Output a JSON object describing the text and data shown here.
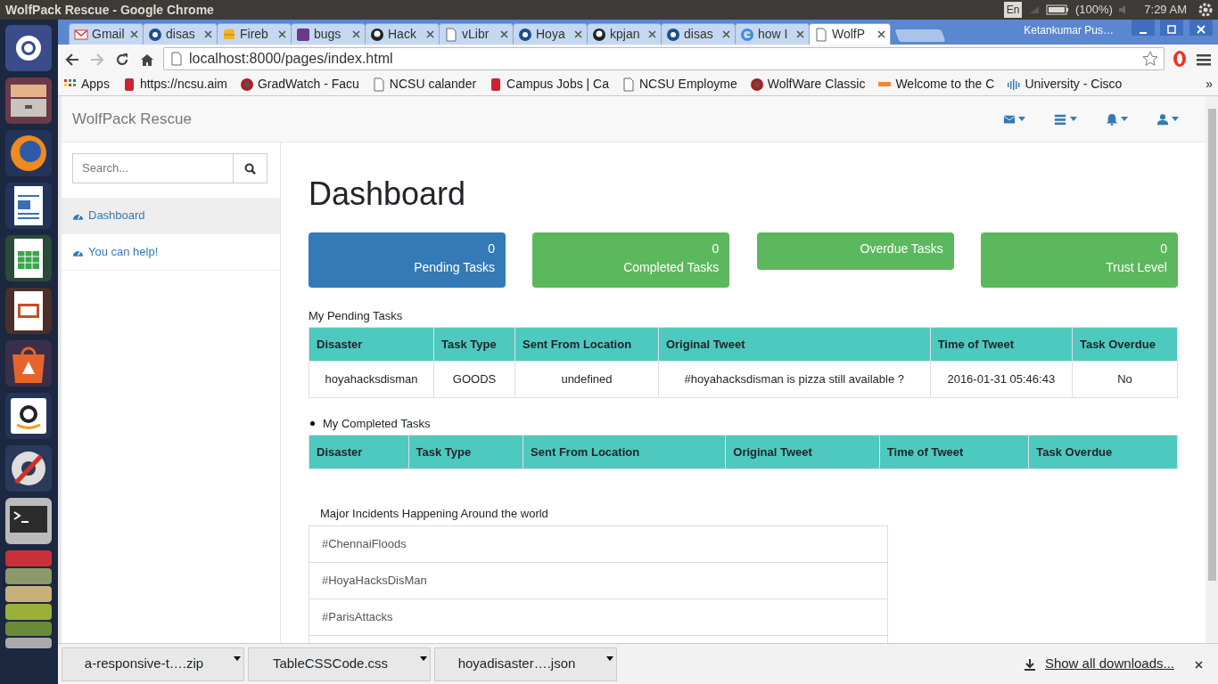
{
  "os_bar": {
    "title": "WolfPack Rescue - Google Chrome",
    "keyboard": "En",
    "battery": "(100%)",
    "time": "7:29 AM"
  },
  "launcher": [
    {
      "kind": "ubuntu"
    },
    {
      "kind": "files"
    },
    {
      "kind": "browser"
    },
    {
      "kind": "writer"
    },
    {
      "kind": "calc"
    },
    {
      "kind": "impress"
    },
    {
      "kind": "software"
    },
    {
      "kind": "shop"
    },
    {
      "kind": "settings"
    },
    {
      "kind": "terminal"
    },
    {
      "kind": "stack"
    }
  ],
  "tabs": [
    {
      "kind": "mail",
      "title": "Gmail",
      "selected": false
    },
    {
      "kind": "disc",
      "title": "disas",
      "selected": false
    },
    {
      "kind": "db",
      "title": "Fireb",
      "selected": false
    },
    {
      "kind": "square",
      "title": "bugs",
      "selected": false
    },
    {
      "kind": "cat",
      "title": "Hack",
      "selected": false
    },
    {
      "kind": "page",
      "title": "vLibr",
      "selected": false
    },
    {
      "kind": "disc",
      "title": "Hoya",
      "selected": false
    },
    {
      "kind": "cat",
      "title": "kpjan",
      "selected": false
    },
    {
      "kind": "disc",
      "title": "disas",
      "selected": false
    },
    {
      "kind": "ring",
      "title": "how I",
      "selected": false
    },
    {
      "kind": "page",
      "title": "WolfP",
      "selected": true
    }
  ],
  "profile": "Ketankumar Pus…",
  "address": "localhost:8000/pages/index.html",
  "bookmarks": [
    {
      "kind": "apps",
      "label": "Apps"
    },
    {
      "kind": "red",
      "label": "https://ncsu.aim"
    },
    {
      "kind": "wolf",
      "label": "GradWatch - Facu"
    },
    {
      "kind": "page",
      "label": "NCSU calander"
    },
    {
      "kind": "red",
      "label": "Campus Jobs | Ca"
    },
    {
      "kind": "page",
      "label": "NCSU Employme"
    },
    {
      "kind": "wolf",
      "label": "WolfWare Classic"
    },
    {
      "kind": "orange",
      "label": "Welcome to the C"
    },
    {
      "kind": "bars",
      "label": "University - Cisco"
    }
  ],
  "bookmarks_more": "»",
  "page": {
    "brand": "WolfPack Rescue",
    "nav_icons": [
      {
        "kind": "envelope"
      },
      {
        "kind": "tasks"
      },
      {
        "kind": "bell"
      },
      {
        "kind": "user"
      }
    ],
    "search": {
      "placeholder": "Search..."
    },
    "sidebar": [
      {
        "label": "Dashboard",
        "selected": true
      },
      {
        "label": "You can help!",
        "selected": false
      }
    ],
    "heading": "Dashboard",
    "stats": [
      {
        "count": "0",
        "label": "Pending Tasks",
        "color": "#337ab7"
      },
      {
        "count": "0",
        "label": "Completed Tasks",
        "color": "#5cb85c"
      },
      {
        "label": "Overdue Tasks",
        "color": "#5cb85c"
      },
      {
        "count": "0",
        "label": "Trust Level",
        "color": "#5cb85c"
      }
    ],
    "pending": {
      "title": "My Pending Tasks",
      "columns": [
        "Disaster",
        "Task Type",
        "Sent From Location",
        "Original Tweet",
        "Time of Tweet",
        "Task Overdue"
      ],
      "rows": [
        [
          "hoyahacksdisman",
          "GOODS",
          "undefined",
          "#hoyahacksdisman is pizza still available ?",
          "2016-01-31 05:46:43",
          "No"
        ]
      ]
    },
    "completed": {
      "title": "My Completed Tasks",
      "columns": [
        "Disaster",
        "Task Type",
        "Sent From Location",
        "Original Tweet",
        "Time of Tweet",
        "Task Overdue"
      ]
    },
    "incidents": {
      "title": "Major Incidents Happening Around the world",
      "items": [
        "#ChennaiFloods",
        "#HoyaHacksDisMan",
        "#ParisAttacks"
      ]
    }
  },
  "downloads": {
    "items": [
      "a-responsive-t….zip",
      "TableCSSCode.css",
      "hoyadisaster….json"
    ],
    "show_all": "Show all downloads..."
  }
}
